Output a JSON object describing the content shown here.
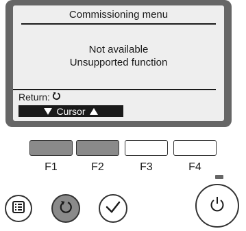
{
  "screen": {
    "title": "Commissioning menu",
    "message_line1": "Not available",
    "message_line2": "Unsupported function",
    "return_label": "Return:",
    "return_icon": "return-arrow-icon",
    "cursor_label": "Cursor",
    "cursor_down_icon": "triangle-down-icon",
    "cursor_up_icon": "triangle-up-icon"
  },
  "function_keys": [
    {
      "label": "F1",
      "state": "shaded"
    },
    {
      "label": "F2",
      "state": "shaded"
    },
    {
      "label": "F3",
      "state": "plain"
    },
    {
      "label": "F4",
      "state": "plain"
    }
  ],
  "buttons": {
    "menu": {
      "icon": "menu-icon"
    },
    "return": {
      "icon": "return-arrow-icon"
    },
    "confirm": {
      "icon": "checkmark-icon"
    },
    "power": {
      "icon": "power-icon"
    }
  },
  "colors": {
    "lcd_frame": "#666666",
    "lcd_background": "#eeeeee",
    "function_key_shaded": "#8a8a8a",
    "return_button_fill": "#8a8a8a"
  }
}
